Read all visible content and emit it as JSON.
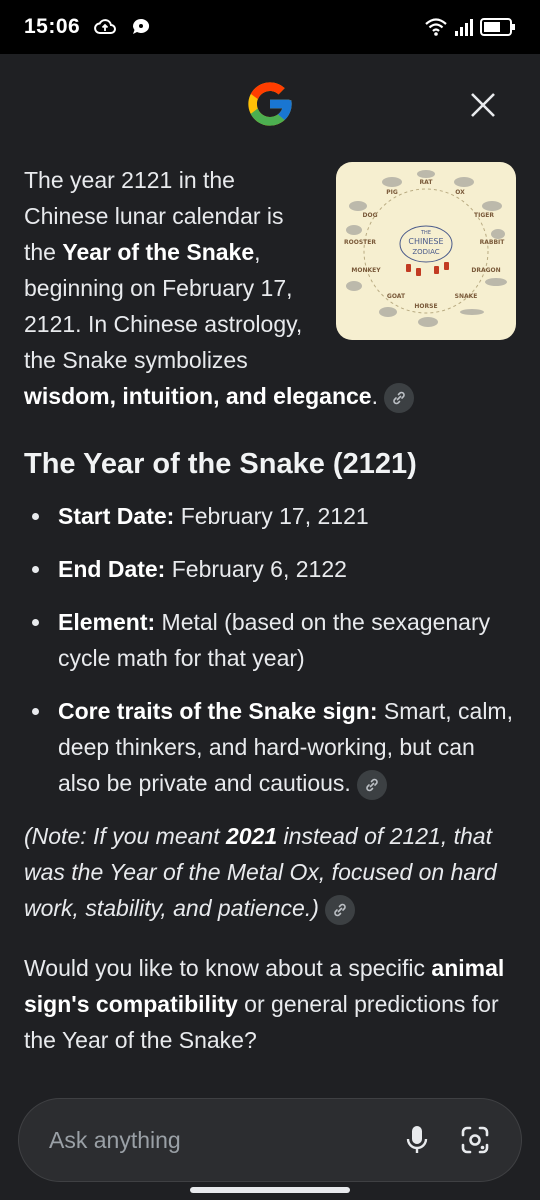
{
  "status_bar": {
    "time": "15:06"
  },
  "header": {
    "logo": "google-g-logo",
    "close_icon": "close-icon"
  },
  "intro": {
    "text_1": "The year 2121 in the Chinese lunar calendar is the ",
    "text_bold_1": "Year of the Snake",
    "text_2": ", beginning on February 17, 2121. In Chinese astrology, the Snake symbolizes ",
    "text_bold_2": "wisdom, intuition, and elegance",
    "text_3": ".",
    "image": {
      "title_line1": "THE",
      "title_line2": "CHINESE",
      "title_line3": "ZODIAC",
      "animals": [
        "RAT",
        "OX",
        "TIGER",
        "RABBIT",
        "DRAGON",
        "SNAKE",
        "HORSE",
        "GOAT",
        "MONKEY",
        "ROOSTER",
        "DOG",
        "PIG"
      ]
    }
  },
  "section": {
    "title": "The Year of the Snake (2121)",
    "facts": [
      {
        "label": "Start Date:",
        "value": " February 17, 2121"
      },
      {
        "label": "End Date:",
        "value": " February 6, 2122"
      },
      {
        "label": "Element:",
        "value": " Metal (based on the sexagenary cycle math for that year)"
      },
      {
        "label": "Core traits of the Snake sign:",
        "value": " Smart, calm, deep thinkers, and hard-working, but can also be private and cautious."
      }
    ]
  },
  "note": {
    "text_1": "(Note: If you meant ",
    "bold": "2021",
    "text_2": " instead of 2121, that was the Year of the Metal Ox, focused on hard work, stability, and patience.)"
  },
  "question": {
    "text_1": "Would you like to know about a specific ",
    "bold": "animal sign's compatibility",
    "text_2": " or general predictions for the Year of the Snake?"
  },
  "ask_bar": {
    "placeholder": "Ask anything",
    "mic_icon": "mic-icon",
    "lens_icon": "lens-camera-icon"
  },
  "colors": {
    "background": "#1f2023",
    "text": "#e8eaed",
    "chip": "#3c4043",
    "input_bg": "#2c2d30"
  }
}
